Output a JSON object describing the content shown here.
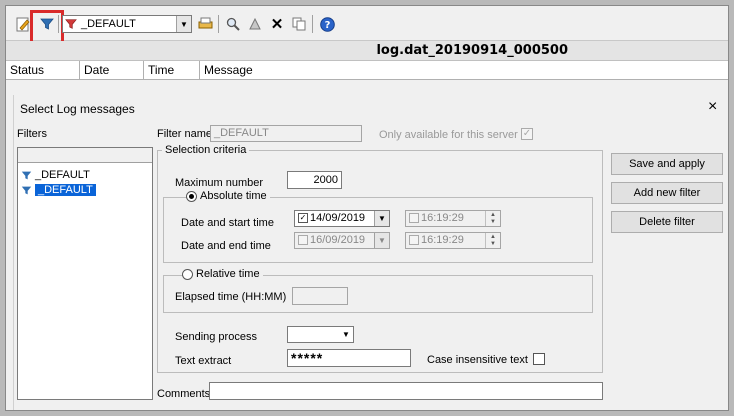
{
  "toolbar": {
    "filter_combo_value": "_DEFAULT"
  },
  "file_title": "log.dat_20190914_000500",
  "columns": [
    "Status",
    "Date",
    "Time",
    "Message"
  ],
  "dialog": {
    "title": "Select Log messages",
    "close": "×",
    "filters_label": "Filters",
    "filter_list": [
      "_DEFAULT",
      "_DEFAULT"
    ],
    "filter_name_label": "Filter name",
    "filter_name_value": "_DEFAULT",
    "only_server_label": "Only available for this server",
    "selection_criteria_label": "Selection criteria",
    "max_number_label": "Maximum number",
    "max_number_value": "2000",
    "absolute_time_label": "Absolute time",
    "start_label": "Date and start time",
    "start_date": "14/09/2019",
    "start_time": "16:19:29",
    "end_label": "Date and end time",
    "end_date": "16/09/2019",
    "end_time": "16:19:29",
    "relative_time_label": "Relative time",
    "elapsed_label": "Elapsed time (HH:MM)",
    "sending_process_label": "Sending process",
    "text_extract_label": "Text extract",
    "text_extract_value": "*****",
    "case_insensitive_label": "Case insensitive text",
    "comments_label": "Comments",
    "save_apply": "Save and apply",
    "add_filter": "Add new filter",
    "delete_filter": "Delete filter"
  }
}
